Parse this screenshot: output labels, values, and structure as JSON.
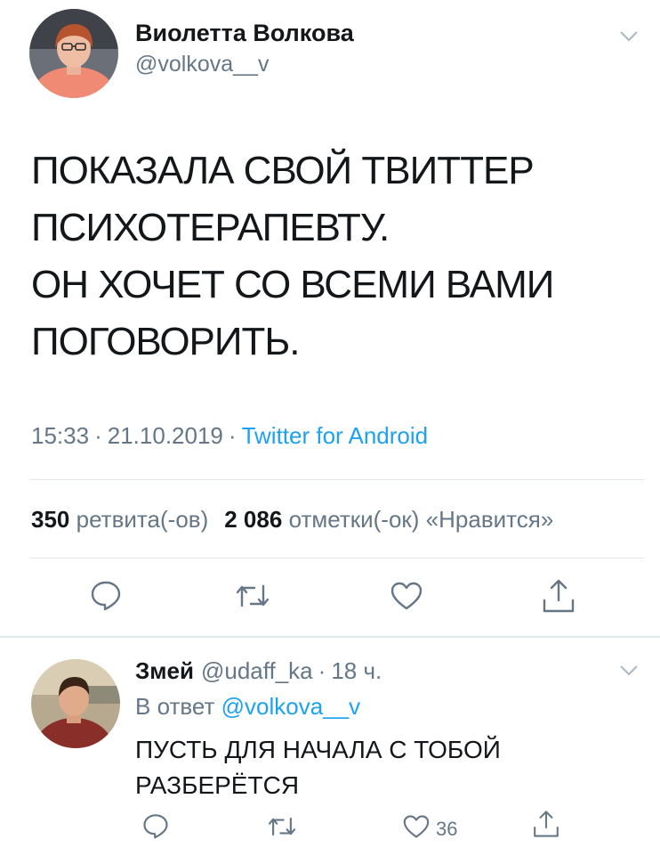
{
  "main_tweet": {
    "display_name": "Виолетта Волкова",
    "handle": "@volkova__v",
    "text": "ПОКАЗАЛА СВОЙ ТВИТТЕР\nПСИХОТЕРАПЕВТУ.\nОН ХОЧЕТ СО ВСЕМИ ВАМИ\nПОГОВОРИТЬ.",
    "time": "15:33",
    "date": "21.10.2019",
    "separator": "·",
    "source": "Twitter for Android",
    "retweets_count": "350",
    "retweets_label": "ретвита(-ов)",
    "likes_count": "2 086",
    "likes_label": "отметки(-ок) «Нравится»"
  },
  "reply": {
    "display_name": "Змей",
    "handle": "@udaff_ka",
    "separator": "·",
    "age": "18 ч.",
    "reply_prefix": "В ответ",
    "reply_mention": "@volkova__v",
    "text": "ПУСТЬ ДЛЯ НАЧАЛА С ТОБОЙ\nРАЗБЕРЁТСЯ",
    "like_count": "36"
  },
  "icons": {
    "reply": "reply-icon",
    "retweet": "retweet-icon",
    "like": "heart-icon",
    "share": "share-icon",
    "menu": "chevron-down-icon"
  },
  "colors": {
    "text": "#14171a",
    "secondary": "#657786",
    "link": "#1da1f2",
    "divider": "#e1e8ed"
  }
}
